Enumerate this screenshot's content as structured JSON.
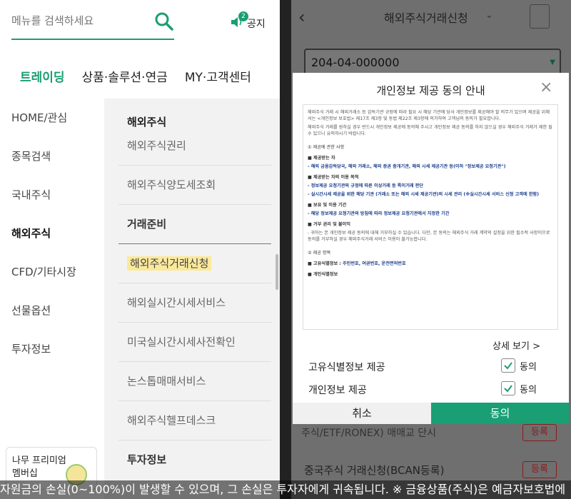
{
  "left": {
    "search_placeholder": "메뉴를 검색하세요",
    "notice_label": "공지",
    "notice_badge": "2",
    "tabs": [
      "트레이딩",
      "상품·솔루션·연금",
      "MY·고객센터"
    ],
    "side_items": [
      "HOME/관심",
      "종목검색",
      "국내주식",
      "해외주식",
      "CFD/기타시장",
      "선물옵션",
      "투자정보"
    ],
    "sub_head": "해외주식",
    "sub_items": [
      "해외주식권리",
      "해외주식양도세조회",
      "거래준비",
      "해외주식거래신청",
      "해외실시간시세서비스",
      "미국실시간시세사전확인",
      "논스톱매매서비스",
      "해외주식헬프데스크",
      "투자정보"
    ],
    "premium_line1": "나무 프리미엄",
    "premium_line2": "멤버십"
  },
  "right": {
    "title": "해외주식거래신청",
    "account": "204-04-000000",
    "bottom_row1": "주식/ETF/RONEX) 매매교 단시",
    "bottom_row2": "중국주식 거래신청(BCAN등록)",
    "register_label": "등록"
  },
  "modal": {
    "title": "개인정보 제공 동의 안내",
    "doc_intro": "해외주식 거래 시 해외거래소 등 감독기관 규정에 따라 필요 시 해당 기관에 당사 개인정보를 제공해야 할 의무가 있으며 제공을 위해서는 <개인정보 보호법> 제17조 제3항 및 동법 제22조 제3항에 의거하여 고객님의 동의가 필요합니다.",
    "doc_intro2": "해외주식 거래를 원하실 경우 반드시 개인정보 제공에 동의해 주시고 개인정보 제공 동의를 하지 않으실 경우 해외주식 거래가 제한 될 수 있으니 유의하시기 바랍니다.",
    "sec1": "① 제공에 관한 사항",
    "recipient_head": "■ 제공받는 자",
    "recipient": "- 해외 금융감독당국, 해외 거래소, 해외 증권 중개기관, 해외 시세 제공기관 등(이하 \"정보제공 요청기관\")",
    "purpose_head": "■ 제공받는 자의 이용 목적",
    "purpose1": "- 정보제공 요청기관의 규정에 따른 이상거래 등 특이거래 판단",
    "purpose2": "- 실시간시세 제공을 위한 해당 기관 (거래소 또는 해외 시세 제공기관)의 시세 관리 (※실시간시세 서비스 신청 고객에 한함)",
    "retention_head": "■ 보유 및 이용 기간",
    "retention": "- 해당 정보제공 요청기관의 방침에 따라 정보제공 요청기관에서 지정한 기간",
    "refusal_head": "■ 거부 권리 및 불이익",
    "refusal": "- 귀하는 본 개인정보 제공 동의에 대해 거부하실 수 있습니다. 다만, 본 동의는 해외주식 거래 계약의 설정을 위한 필수적 사항이므로 동의를 거부하실 경우 해외주식거래 서비스 이용이 불가능합니다.",
    "sec2": "② 제공 항목",
    "items_head": "■ 고유식별정보 :",
    "items": "주민번호, 여권번호, 운전면허번호",
    "cut_line": "■ 개인식별정보",
    "detail_label": "상세 보기 >",
    "row1_label": "고유식별정보 제공",
    "row2_label": "개인정보 제공",
    "check_label": "동의",
    "cancel_label": "취소",
    "agree_label": "동의"
  },
  "ticker": "자원금의 손실(0~100%)이 발생할 수 있으며, 그 손실은 투자자에게 귀속됩니다. ※ 금융상품(주식)은 예금자보호법에"
}
